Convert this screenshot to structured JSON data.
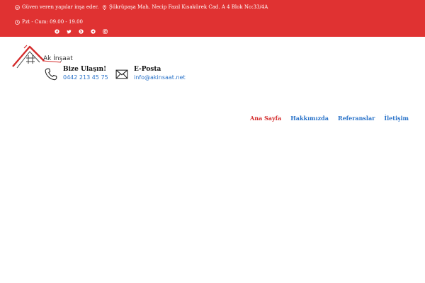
{
  "topbar": {
    "tagline": "Güven veren yapılar inşa eder.",
    "address": "Şükrüpaşa Mah. Necip Fazıl Kısakürek Cad. A 4 Blok No:33/4A",
    "hours": "Pzt - Cum: 09.00 - 19.00",
    "social": [
      "facebook-icon",
      "twitter-icon",
      "skype-icon",
      "telegram-icon",
      "instagram-icon"
    ]
  },
  "brand": {
    "name": "Ak İnşaat"
  },
  "contact": {
    "phone_label": "Bize Ulaşın!",
    "phone": "0442 213 45 75",
    "email_label": "E-Posta",
    "email": "info@akinsaat.net"
  },
  "nav": {
    "items": [
      {
        "label": "Ana Sayfa",
        "active": true
      },
      {
        "label": "Hakkımızda",
        "active": false
      },
      {
        "label": "Referanslar",
        "active": false
      },
      {
        "label": "İletişim",
        "active": false
      }
    ]
  },
  "colors": {
    "topbar": "#e03232",
    "link": "#2a73c9",
    "active": "#d42b2b"
  }
}
